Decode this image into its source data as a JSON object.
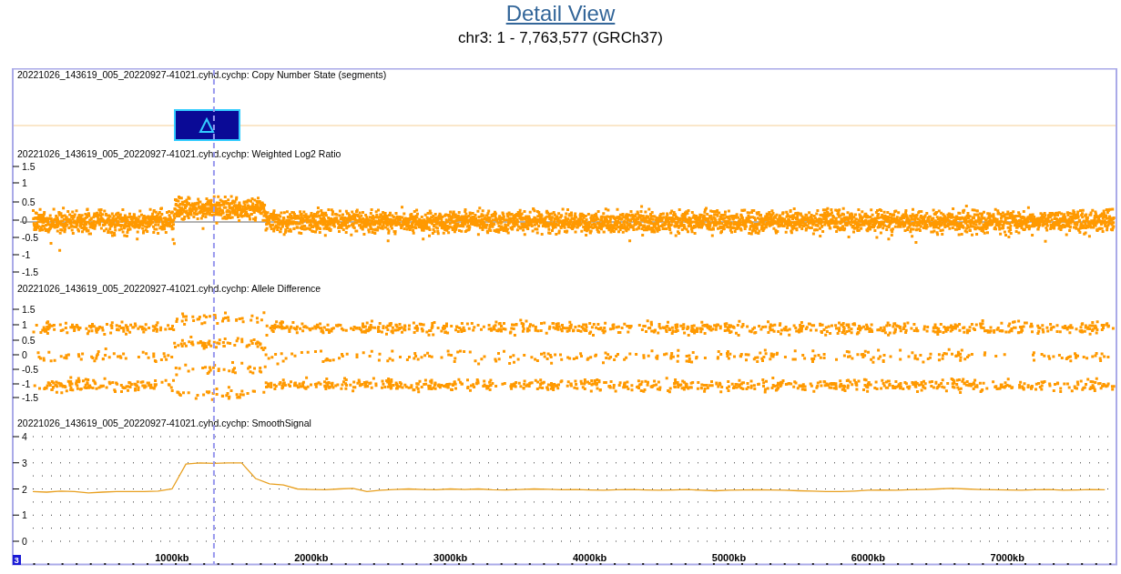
{
  "title": "Detail View",
  "subtitle": "chr3: 1 - 7,763,577 (GRCh37)",
  "tracks": [
    {
      "kind": "segments",
      "title": "20221026_143619_005_20220927-41021.cyhd.cychp: Copy Number State (segments)"
    },
    {
      "kind": "scatter",
      "title": "20221026_143619_005_20220927-41021.cyhd.cychp: Weighted Log2 Ratio",
      "yticks": [
        "1.5",
        "1",
        "0.5",
        "0",
        "-0.5",
        "-1",
        "-1.5"
      ]
    },
    {
      "kind": "bands",
      "title": "20221026_143619_005_20220927-41021.cyhd.cychp: Allele Difference",
      "yticks": [
        "1.5",
        "1",
        "0.5",
        "0",
        "-0.5",
        "-1",
        "-1.5"
      ]
    },
    {
      "kind": "line",
      "title": "20221026_143619_005_20220927-41021.cyhd.cychp: SmoothSignal",
      "chart_data": {
        "type": "line",
        "grid": true,
        "ref_lines": [
          {
            "axis": "x",
            "value": 1301,
            "color": "#9999ee"
          }
        ],
        "ylim": [
          0,
          4
        ],
        "xlim": [
          0,
          7763.577
        ],
        "yticks": [
          {
            "value": 4,
            "label": "4"
          },
          {
            "value": 3,
            "label": "3"
          },
          {
            "value": 2,
            "label": "2"
          },
          {
            "value": 1,
            "label": "1"
          },
          {
            "value": 0,
            "label": "0"
          }
        ],
        "xticks": [
          {
            "value": 1000,
            "label": "1000kb"
          },
          {
            "value": 2000,
            "label": "2000kb"
          },
          {
            "value": 3000,
            "label": "3000kb"
          },
          {
            "value": 4000,
            "label": "4000kb"
          },
          {
            "value": 5000,
            "label": "5000kb"
          },
          {
            "value": 6000,
            "label": "6000kb"
          },
          {
            "value": 7000,
            "label": "7000kb"
          }
        ],
        "x": [
          0,
          100,
          200,
          300,
          400,
          500,
          600,
          700,
          800,
          900,
          1000,
          1100,
          1200,
          1300,
          1400,
          1500,
          1600,
          1700,
          1800,
          1900,
          2000,
          2100,
          2200,
          2300,
          2400,
          2500,
          2600,
          2700,
          2800,
          2900,
          3000,
          3100,
          3200,
          3300,
          3400,
          3500,
          3600,
          3700,
          3800,
          3900,
          4000,
          4100,
          4200,
          4300,
          4400,
          4500,
          4600,
          4700,
          4800,
          4900,
          5000,
          5100,
          5200,
          5300,
          5400,
          5500,
          5600,
          5700,
          5800,
          5900,
          6000,
          6100,
          6200,
          6300,
          6400,
          6500,
          6600,
          6700,
          6800,
          6900,
          7000,
          7100,
          7200,
          7300,
          7400,
          7500,
          7600,
          7700
        ],
        "series": [
          {
            "color": "#e8a020",
            "values": [
              1.9,
              1.88,
              1.92,
              1.9,
              1.85,
              1.88,
              1.9,
              1.9,
              1.9,
              1.92,
              2.0,
              2.95,
              3.0,
              2.98,
              3.0,
              3.0,
              2.4,
              2.2,
              2.15,
              2.0,
              1.98,
              1.97,
              2.0,
              2.02,
              1.9,
              1.95,
              1.98,
              2.0,
              1.98,
              1.97,
              2.0,
              1.98,
              2.0,
              1.97,
              1.96,
              1.98,
              2.0,
              1.99,
              1.97,
              1.98,
              1.96,
              1.95,
              1.97,
              1.98,
              1.96,
              1.95,
              1.96,
              1.98,
              1.95,
              1.93,
              1.95,
              1.96,
              1.97,
              1.96,
              1.95,
              1.93,
              1.92,
              1.9,
              1.9,
              1.92,
              1.95,
              1.96,
              1.95,
              1.97,
              1.98,
              2.0,
              2.02,
              2.0,
              1.98,
              1.97,
              1.96,
              1.95,
              1.97,
              1.98,
              1.95,
              1.96,
              1.98,
              1.97
            ]
          }
        ]
      }
    }
  ],
  "chromosome": "3"
}
